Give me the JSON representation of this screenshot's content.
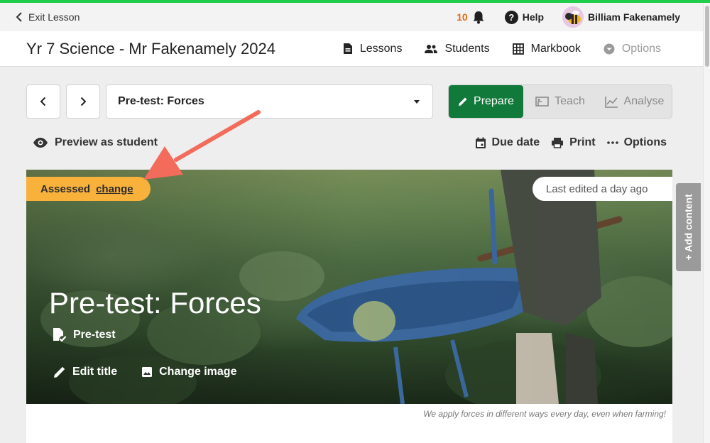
{
  "progress": {
    "percent": 100,
    "color": "#1fcd4a"
  },
  "topbar": {
    "exit_label": "Exit Lesson",
    "notification_count": "10",
    "help_label": "Help",
    "user_name": "Billiam Fakenamely"
  },
  "classbar": {
    "class_title": "Yr 7 Science - Mr Fakenamely 2024",
    "nav": [
      {
        "label": "Lessons",
        "icon": "document-icon"
      },
      {
        "label": "Students",
        "icon": "people-icon"
      },
      {
        "label": "Markbook",
        "icon": "grid-icon"
      },
      {
        "label": "Options",
        "icon": "gear-icon",
        "disabled": true
      }
    ]
  },
  "lesson_select": {
    "value": "Pre-test: Forces"
  },
  "modes": [
    {
      "label": "Prepare",
      "active": true,
      "icon": "pencil-icon"
    },
    {
      "label": "Teach",
      "active": false,
      "icon": "board-icon"
    },
    {
      "label": "Analyse",
      "active": false,
      "icon": "chart-icon"
    }
  ],
  "toolbar": {
    "preview_label": "Preview as student",
    "due_date_label": "Due date",
    "print_label": "Print",
    "options_label": "Options"
  },
  "hero": {
    "badge_label": "Assessed",
    "badge_link": "change",
    "last_edited": "Last edited a day ago",
    "title": "Pre-test: Forces",
    "type_label": "Pre-test",
    "edit_title_label": "Edit title",
    "change_image_label": "Change image",
    "caption": "We apply forces in different ways every day, even when farming!"
  },
  "add_content_label": "Add content",
  "colors": {
    "accent_green": "#117a3b",
    "badge_orange": "#f8b13b",
    "arrow_red": "#f26b5b",
    "notification_orange": "#e06a1b"
  }
}
